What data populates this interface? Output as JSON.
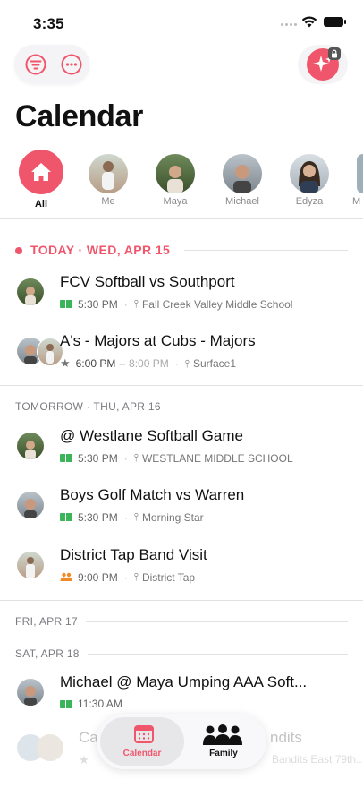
{
  "status": {
    "time": "3:35"
  },
  "page": {
    "title": "Calendar"
  },
  "people": [
    {
      "label": "All"
    },
    {
      "label": "Me"
    },
    {
      "label": "Maya"
    },
    {
      "label": "Michael"
    },
    {
      "label": "Edyza"
    },
    {
      "label": "M"
    }
  ],
  "sections": {
    "today": "TODAY · WED, APR 15",
    "tomorrow": "TOMORROW · THU, APR 16",
    "fri": "FRI, APR 17",
    "sat": "SAT, APR 18"
  },
  "events": [
    {
      "title": "FCV Softball vs Southport",
      "time": "5:30 PM",
      "location": "Fall Creek Valley Middle School"
    },
    {
      "title": "A's - Majors at Cubs - Majors",
      "time": "6:00 PM",
      "end_time": "8:00 PM",
      "location": "Surface1"
    },
    {
      "title": "@ Westlane Softball Game",
      "time": "5:30 PM",
      "location": "WESTLANE MIDDLE SCHOOL"
    },
    {
      "title": "Boys Golf Match vs Warren",
      "time": "5:30 PM",
      "location": "Morning Star"
    },
    {
      "title": "District Tap Band Visit",
      "time": "9:00 PM",
      "location": "District Tap"
    },
    {
      "title": "Michael @ Maya Umping AAA Soft...",
      "time": "11:30 AM"
    },
    {
      "title": "Ca",
      "title_tail": "ndits",
      "location": "Bandits East 79th..."
    }
  ],
  "tabs": {
    "calendar": "Calendar",
    "family": "Family"
  },
  "colors": {
    "accent": "#f0566b",
    "field": "#3cb45a",
    "family": "#f08a24"
  }
}
